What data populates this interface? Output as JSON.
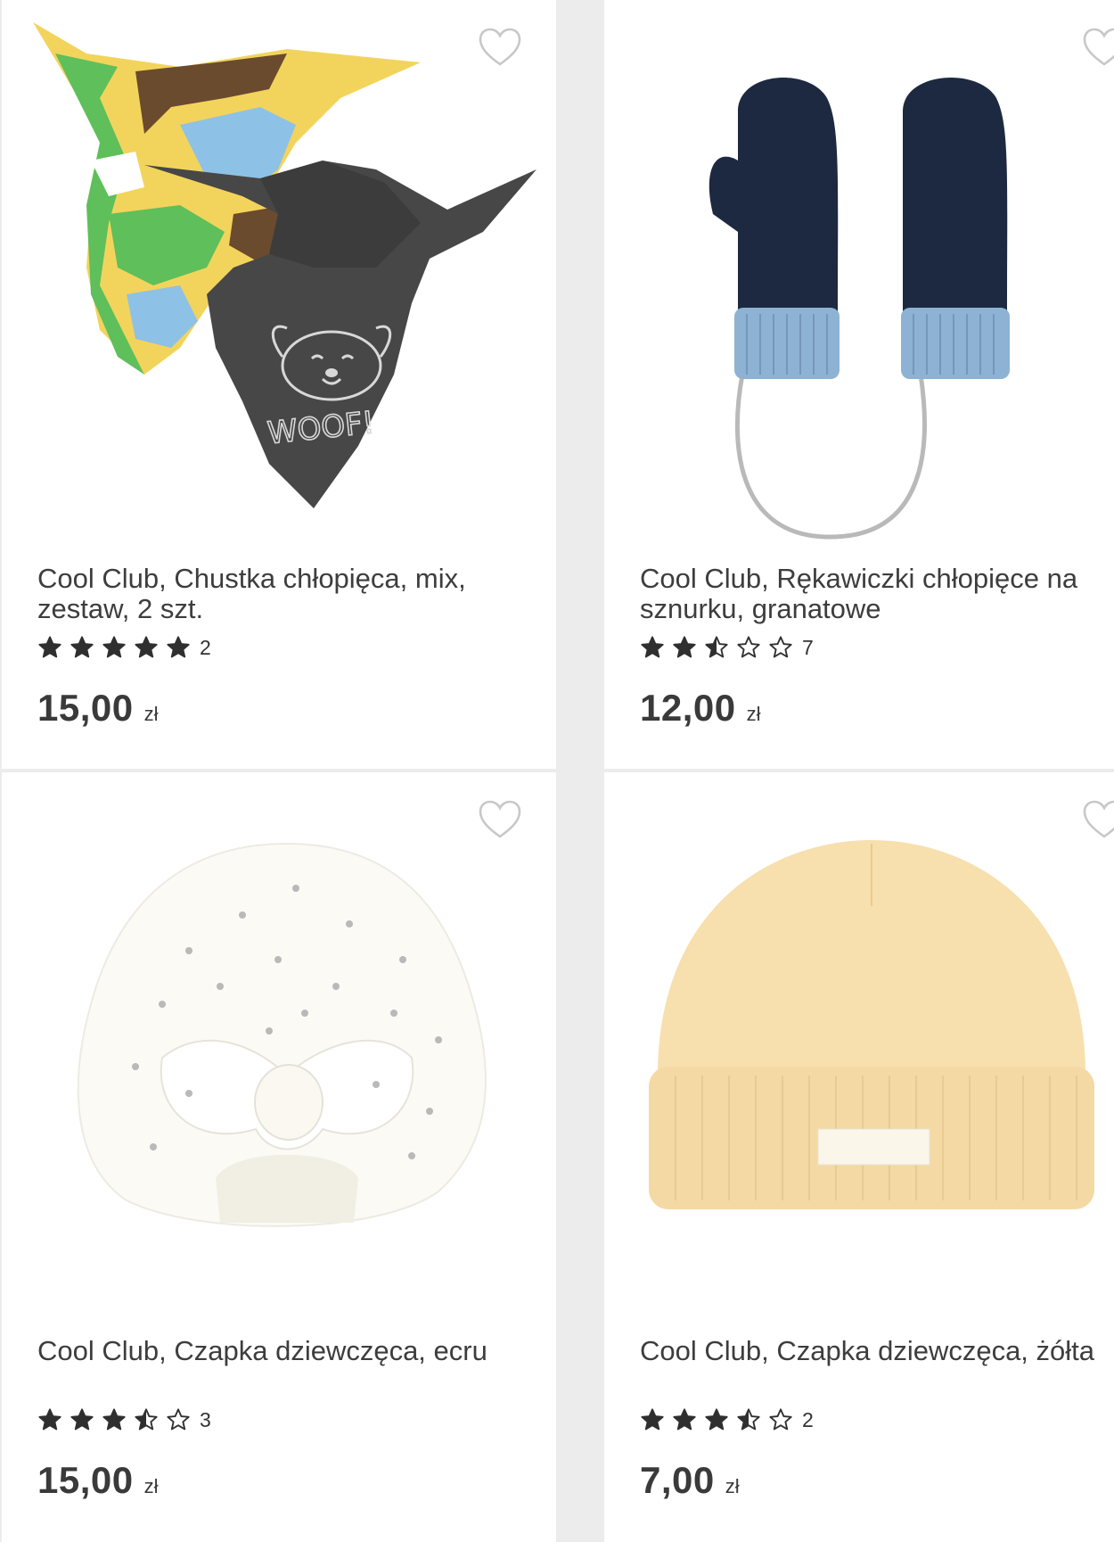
{
  "products": [
    {
      "title": "Cool Club, Chustka chłopięca, mix, zestaw, 2 szt.",
      "rating": 5,
      "review_count": "2",
      "price": "15,00",
      "currency": "zł",
      "image": "bandana-set"
    },
    {
      "title": "Cool Club, Rękawiczki chłopięce na sznurku, granatowe",
      "rating": 2.5,
      "review_count": "7",
      "price": "12,00",
      "currency": "zł",
      "image": "mittens"
    },
    {
      "title": "Cool Club, Czapka dziewczęca, ecru",
      "rating": 3.5,
      "review_count": "3",
      "price": "15,00",
      "currency": "zł",
      "image": "turban-hat"
    },
    {
      "title": "Cool Club, Czapka dziewczęca, żółta",
      "rating": 3.5,
      "review_count": "2",
      "price": "7,00",
      "currency": "zł",
      "image": "beanie"
    }
  ],
  "icons": {
    "favorite": "heart-outline-icon",
    "star_full": "star-filled-icon",
    "star_half": "star-half-icon",
    "star_empty": "star-outline-icon"
  },
  "colors": {
    "background": "#ececec",
    "card": "#ffffff",
    "text": "#3a3a3a",
    "star": "#2f2f2f",
    "heart": "#c8c8c8"
  }
}
